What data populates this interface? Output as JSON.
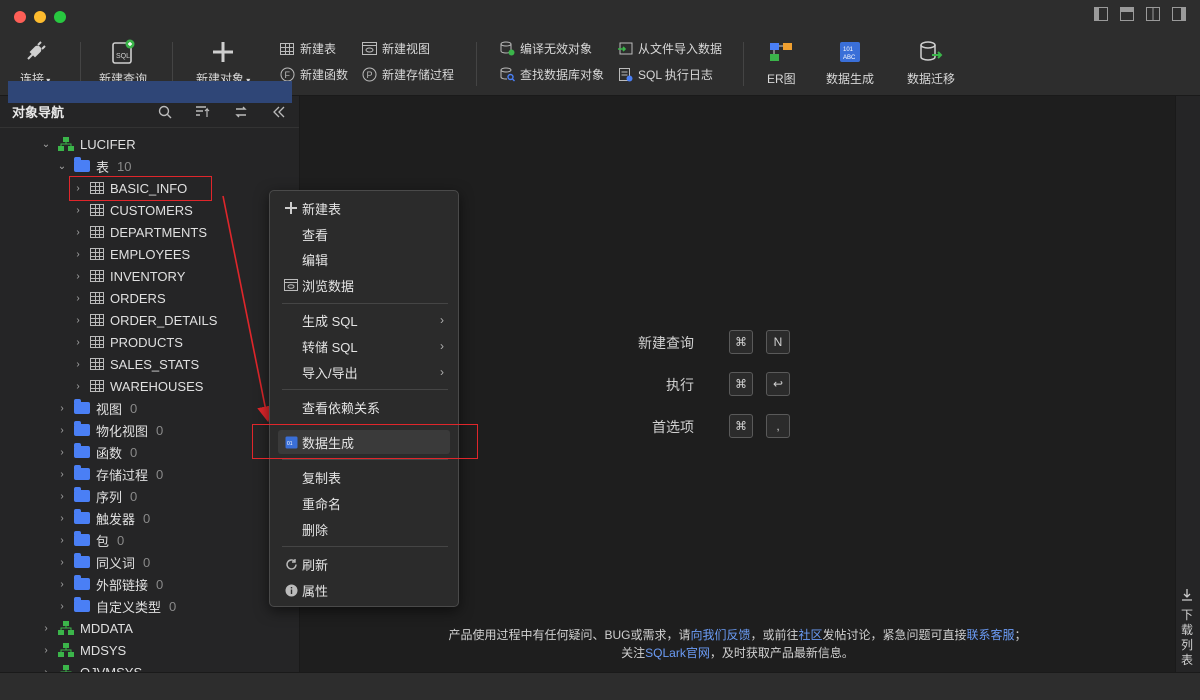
{
  "toolbar": {
    "connect": "连接",
    "new_query": "新建查询",
    "new_object": "新建对象",
    "new_table": "新建表",
    "new_view": "新建视图",
    "new_function": "新建函数",
    "new_procedure": "新建存储过程",
    "compile_invalid": "编译无效对象",
    "find_db_object": "查找数据库对象",
    "import_from_file": "从文件导入数据",
    "sql_log": "SQL 执行日志",
    "er_diagram": "ER图",
    "data_generation": "数据生成",
    "data_migration": "数据迁移"
  },
  "nav": {
    "title": "对象导航",
    "schema": "LUCIFER",
    "tables_label": "表",
    "tables_count": "10",
    "tables": [
      "BASIC_INFO",
      "CUSTOMERS",
      "DEPARTMENTS",
      "EMPLOYEES",
      "INVENTORY",
      "ORDERS",
      "ORDER_DETAILS",
      "PRODUCTS",
      "SALES_STATS",
      "WAREHOUSES"
    ],
    "folders": [
      {
        "label": "视图",
        "count": "0"
      },
      {
        "label": "物化视图",
        "count": "0"
      },
      {
        "label": "函数",
        "count": "0"
      },
      {
        "label": "存储过程",
        "count": "0"
      },
      {
        "label": "序列",
        "count": "0"
      },
      {
        "label": "触发器",
        "count": "0"
      },
      {
        "label": "包",
        "count": "0"
      },
      {
        "label": "同义词",
        "count": "0"
      },
      {
        "label": "外部链接",
        "count": "0"
      },
      {
        "label": "自定义类型",
        "count": "0"
      }
    ],
    "other_schemas": [
      "MDDATA",
      "MDSYS",
      "OJVMSYS"
    ]
  },
  "context_menu": {
    "new_table": "新建表",
    "view": "查看",
    "edit": "编辑",
    "browse_data": "浏览数据",
    "generate_sql": "生成 SQL",
    "dump_sql": "转储 SQL",
    "import_export": "导入/导出",
    "view_dependencies": "查看依赖关系",
    "data_generation": "数据生成",
    "copy_table": "复制表",
    "rename": "重命名",
    "delete": "删除",
    "refresh": "刷新",
    "properties": "属性"
  },
  "shortcuts": {
    "new_query": "新建查询",
    "new_query_keys": [
      "⌘",
      "N"
    ],
    "execute": "执行",
    "execute_keys": [
      "⌘",
      "↩"
    ],
    "preferences": "首选项",
    "preferences_keys": [
      "⌘",
      ","
    ]
  },
  "footer": {
    "line1_a": "产品使用过程中有任何疑问、BUG或需求，请",
    "line1_link1": "向我们反馈",
    "line1_b": "，或前往",
    "line1_link2": "社区",
    "line1_c": "发帖讨论，紧急问题可直接",
    "line1_link3": "联系客服",
    "line1_d": "；",
    "line2_a": "关注",
    "line2_link": "SQLark官网",
    "line2_b": "，及时获取产品最新信息。"
  },
  "right_bar": {
    "download_list": [
      "下",
      "载",
      "列",
      "表"
    ]
  },
  "colors": {
    "accent": "#4a7ff5",
    "selection": "#2f4677",
    "annotation": "#e0262b",
    "link": "#6b9cf6"
  }
}
